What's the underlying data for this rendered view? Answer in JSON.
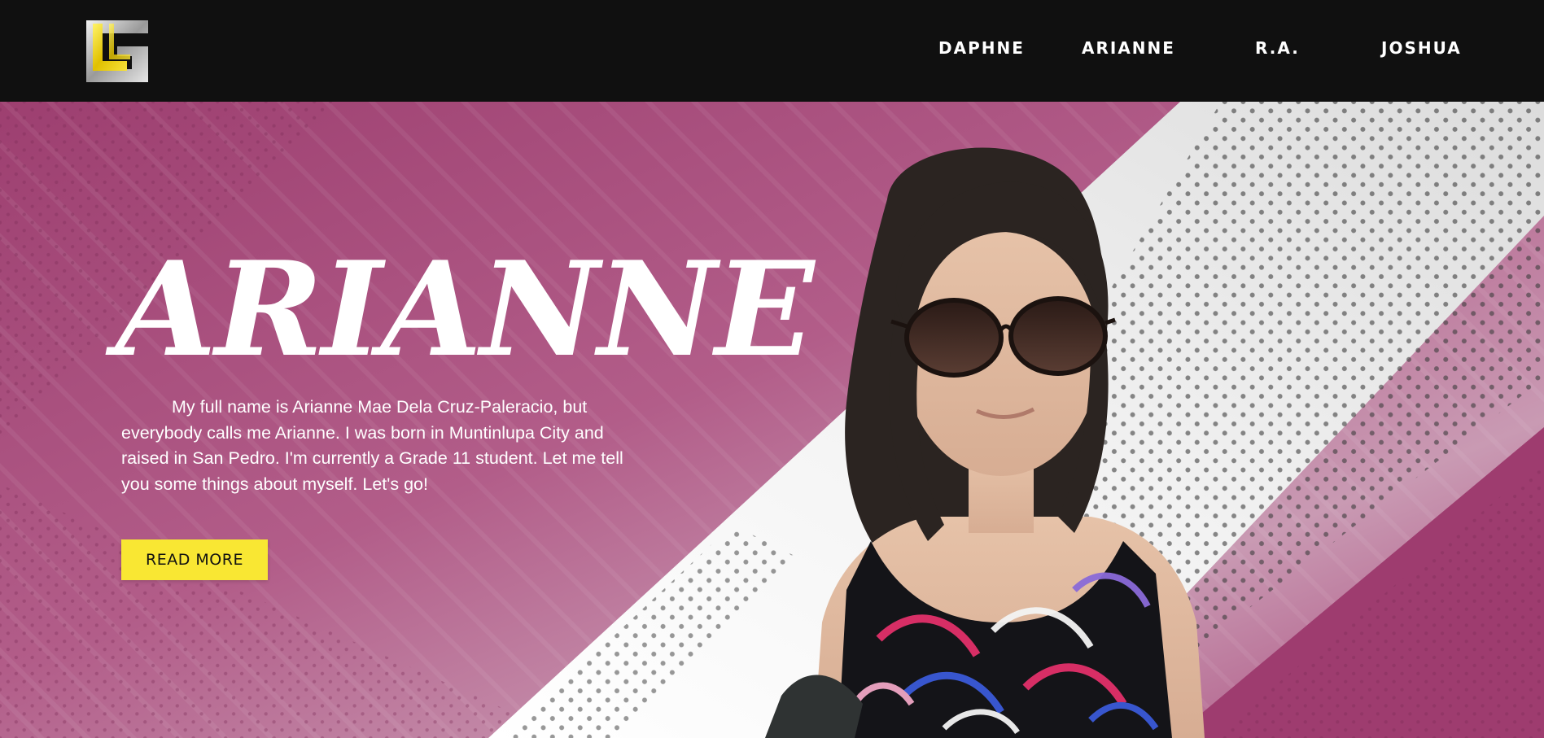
{
  "header": {
    "logo_alt": "LG logo",
    "nav": [
      {
        "label": "DAPHNE"
      },
      {
        "label": "ARIANNE"
      },
      {
        "label": "R.A."
      },
      {
        "label": "JOSHUA"
      }
    ]
  },
  "hero": {
    "title": "ARIANNE",
    "paragraph": "My full name is Arianne Mae Dela Cruz-Paleracio, but everybody calls me Arianne. I was born in Muntinlupa City and raised in San Pedro. I'm currently a Grade 11 student. Let me tell you some things about myself. Let's go!",
    "button_label": "READ MORE",
    "photo_alt": "Photo of Arianne wearing sunglasses and a floral top"
  },
  "colors": {
    "header_bg": "#101010",
    "hero_magenta": "#a8477a",
    "button_yellow": "#f9e733",
    "text_white": "#ffffff"
  }
}
